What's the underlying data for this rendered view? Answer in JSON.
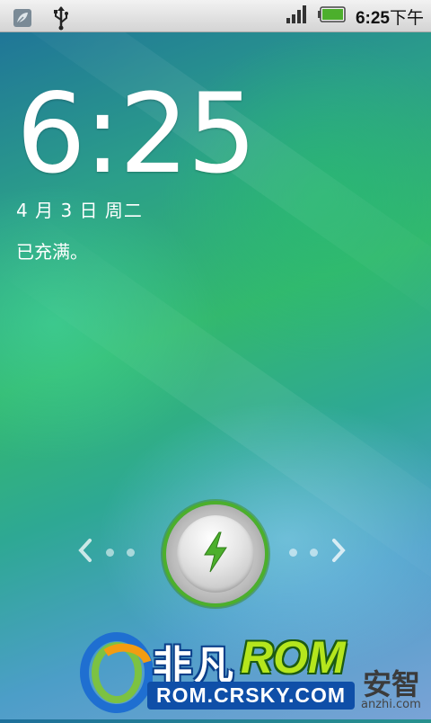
{
  "statusbar": {
    "time": "6:25",
    "ampm": "下午",
    "icons": {
      "notification": "leaf-notification-icon",
      "usb": "usb-icon",
      "signal": "signal-icon",
      "battery": "battery-full-icon"
    },
    "colors": {
      "battery": "#4caf2c"
    }
  },
  "lockscreen": {
    "clock": "6:25",
    "date": "4 月 3 日 周二",
    "status": "已充满。"
  },
  "unlock": {
    "left_arrow": "‹",
    "right_arrow": "›",
    "handle_icon": "lightning-bolt-icon",
    "accent": "#4caf2c"
  },
  "watermark": {
    "brand_cn": "非凡",
    "brand_rom": "ROM",
    "url": "ROM.CRSKY.COM",
    "anzhi_cn": "安智",
    "anzhi_en": "anzhi.com"
  }
}
